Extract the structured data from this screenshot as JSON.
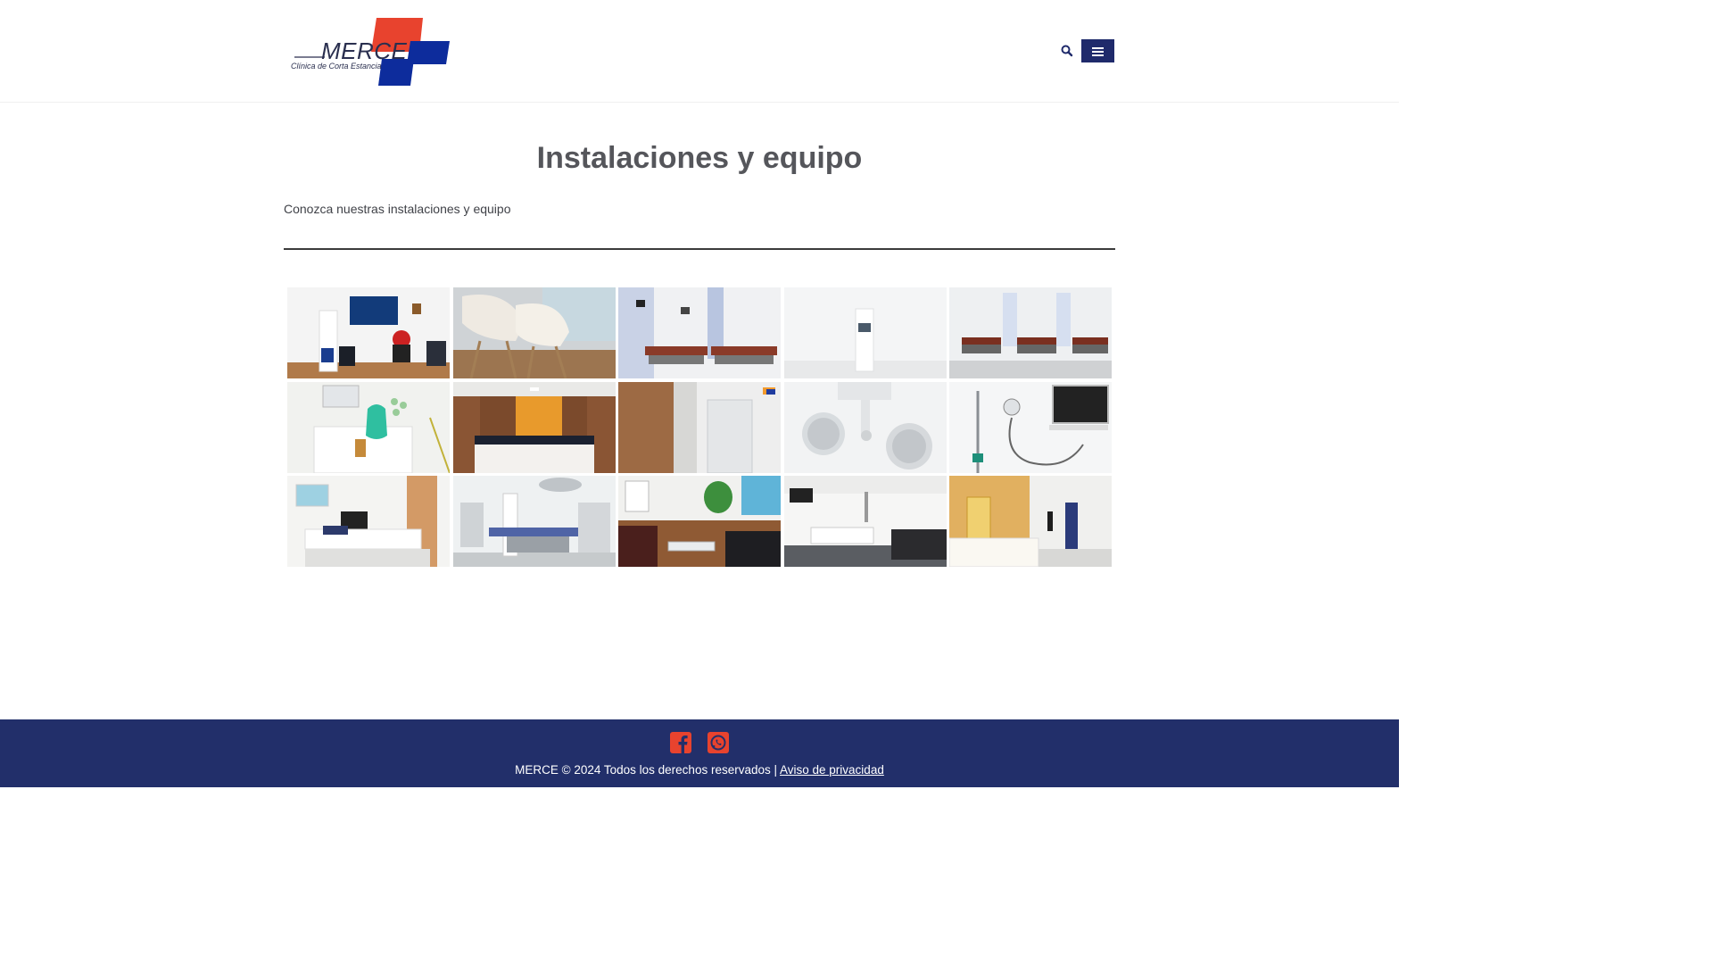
{
  "header": {
    "logo": {
      "word": "MERCE",
      "tagline": "Clínica de Corta Estancia"
    },
    "search_icon": "search-icon",
    "menu_icon": "hamburger-menu-icon"
  },
  "main": {
    "title": "Instalaciones y equipo",
    "intro": "Conozca nuestras instalaciones y equipo"
  },
  "gallery": {
    "rows": 3,
    "columns": 5,
    "photos": [
      "reception-waiting-area",
      "white-chairs-glass-table",
      "recovery-beds-curtains",
      "white-room-door",
      "ward-beds-row",
      "anesthesia-machine",
      "wood-reception-desk",
      "wood-hallway-glass",
      "surgical-lamps",
      "iv-stand-monitor",
      "private-room-bed",
      "operating-room",
      "lounge-leather-sofas",
      "patient-room-sofa",
      "corridor-reception-counter"
    ]
  },
  "footer": {
    "social": [
      "facebook-icon",
      "whatsapp-icon"
    ],
    "copyright": "MERCE © 2024 Todos los derechos reservados |",
    "privacy_link": "Aviso de privacidad"
  },
  "colors": {
    "brand_navy": "#222f6a",
    "brand_red": "#e8432e",
    "menu_button": "#1f2a6b",
    "title_gray": "#55565b"
  }
}
